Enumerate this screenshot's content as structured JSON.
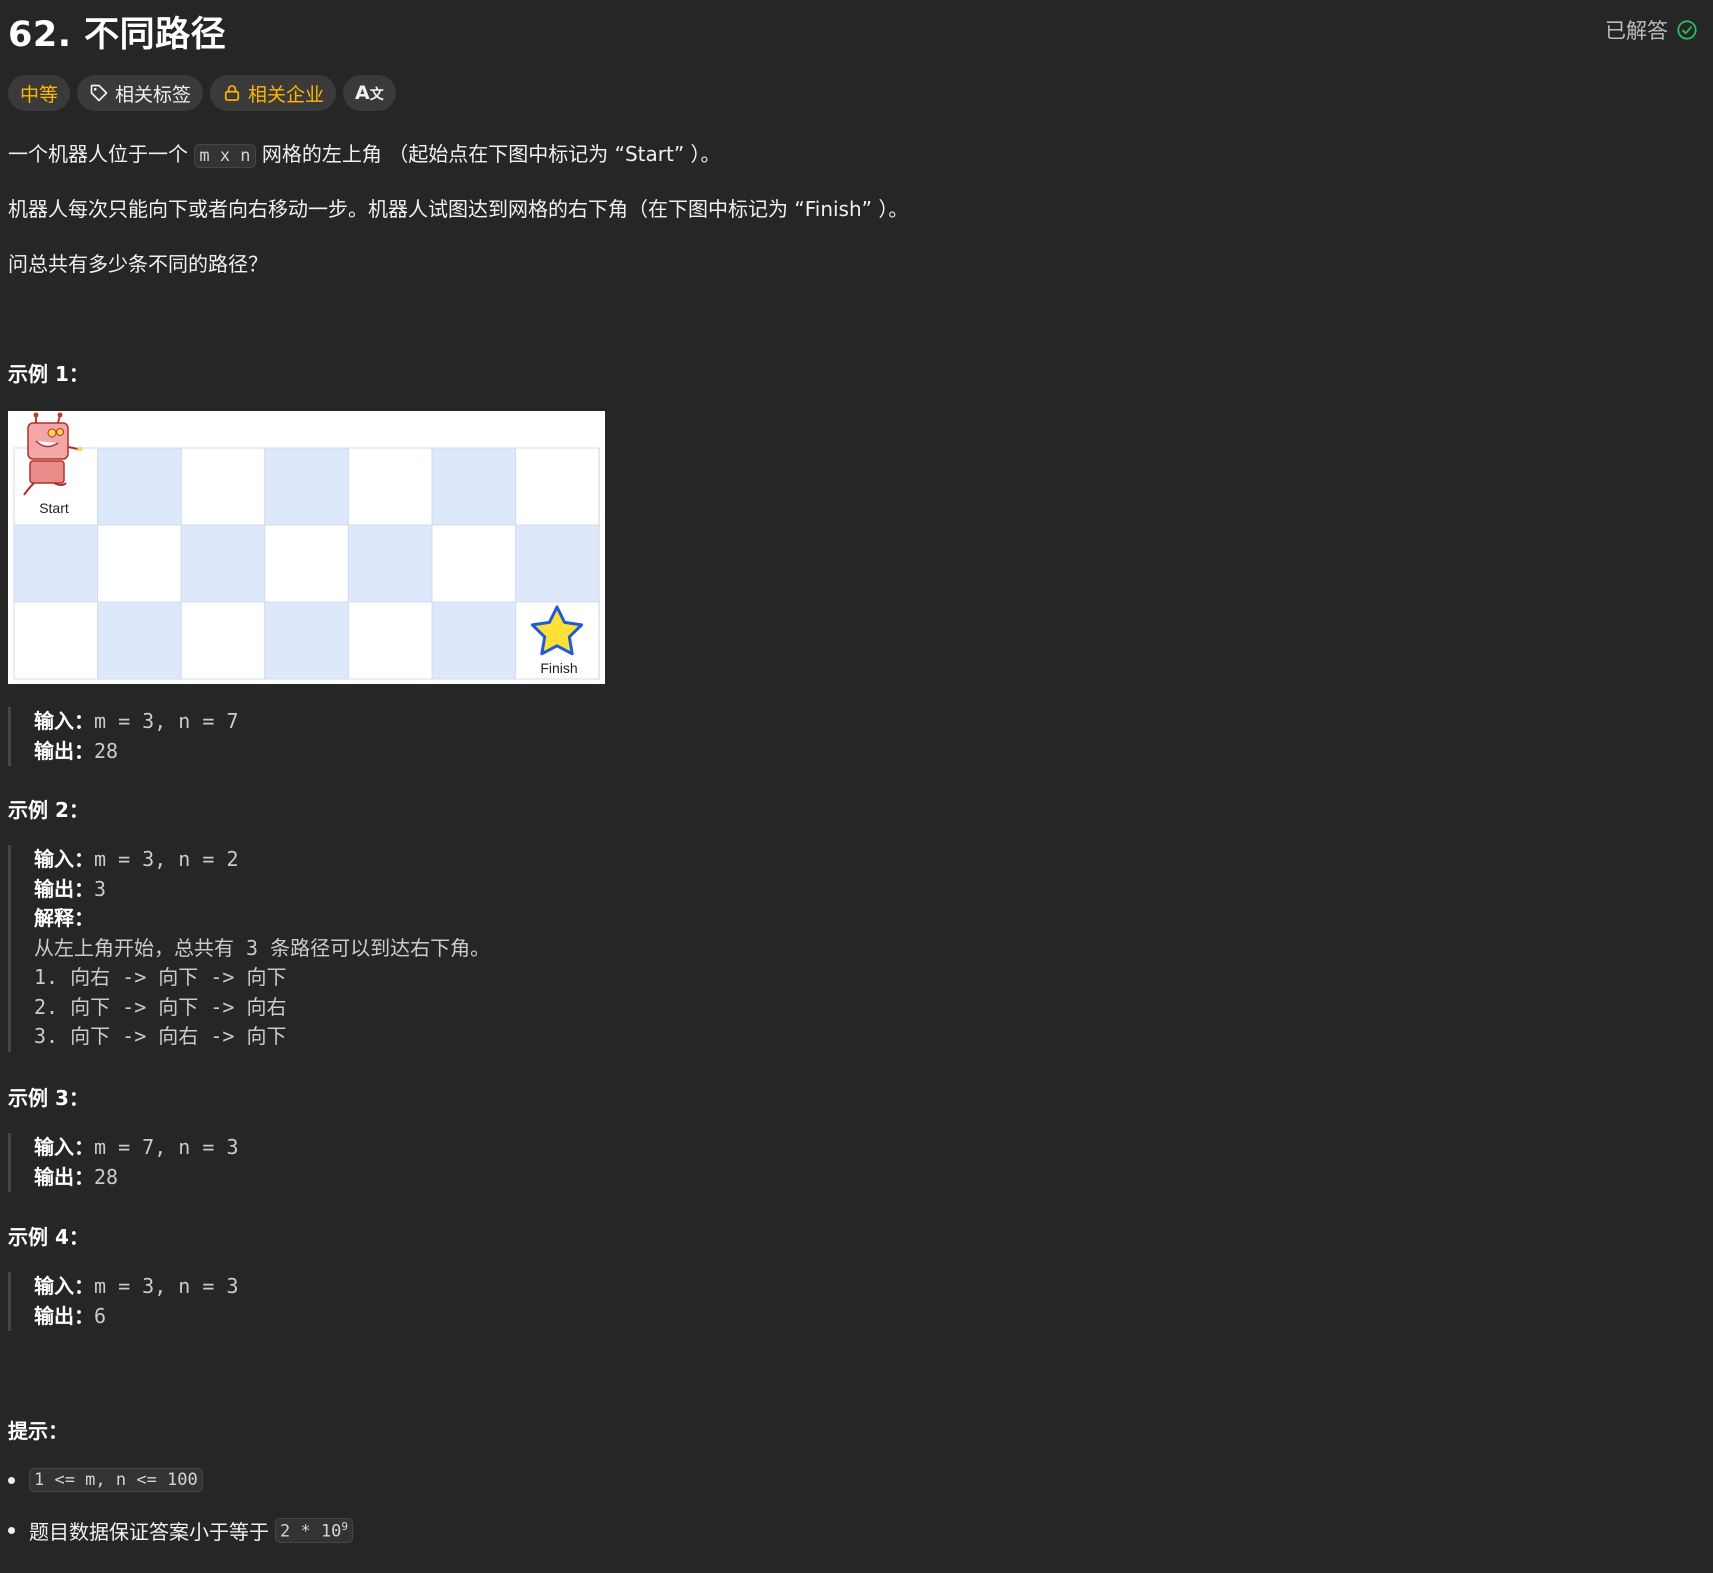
{
  "problem": {
    "title": "62. 不同路径",
    "status": "已解答",
    "tags": {
      "difficulty": "中等",
      "topics": "相关标签",
      "companies": "相关企业",
      "translate": "A"
    },
    "desc1_pre": "一个机器人位于一个",
    "desc1_code": "m x n",
    "desc1_post": "网格的左上角 （起始点在下图中标记为 “Start” ）。",
    "desc2": "机器人每次只能向下或者向右移动一步。机器人试图达到网格的右下角（在下图中标记为 “Finish” ）。",
    "desc3": "问总共有多少条不同的路径？"
  },
  "figure": {
    "start_label": "Start",
    "finish_label": "Finish"
  },
  "examples": [
    {
      "heading": "示例 1：",
      "input_label": "输入：",
      "input": "m = 3, n = 7",
      "output_label": "输出：",
      "output": "28"
    },
    {
      "heading": "示例 2：",
      "input_label": "输入：",
      "input": "m = 3, n = 2",
      "output_label": "输出：",
      "output": "3",
      "explain_label": "解释：",
      "explain_lines": [
        "从左上角开始，总共有 3 条路径可以到达右下角。",
        "1. 向右 -> 向下 -> 向下",
        "2. 向下 -> 向下 -> 向右",
        "3. 向下 -> 向右 -> 向下"
      ]
    },
    {
      "heading": "示例 3：",
      "input_label": "输入：",
      "input": "m = 7, n = 3",
      "output_label": "输出：",
      "output": "28"
    },
    {
      "heading": "示例 4：",
      "input_label": "输入：",
      "input": "m = 3, n = 3",
      "output_label": "输出：",
      "output": "6"
    }
  ],
  "hints": {
    "heading": "提示：",
    "item1_code": "1 <= m, n <= 100",
    "item2_text": "题目数据保证答案小于等于",
    "item2_code_base": "2 * 10",
    "item2_code_exp": "9"
  },
  "colors": {
    "background": "#262626",
    "difficulty": "#ffb800",
    "solved_check": "#2cbb5d",
    "grid_blue": "#dde8fb"
  }
}
